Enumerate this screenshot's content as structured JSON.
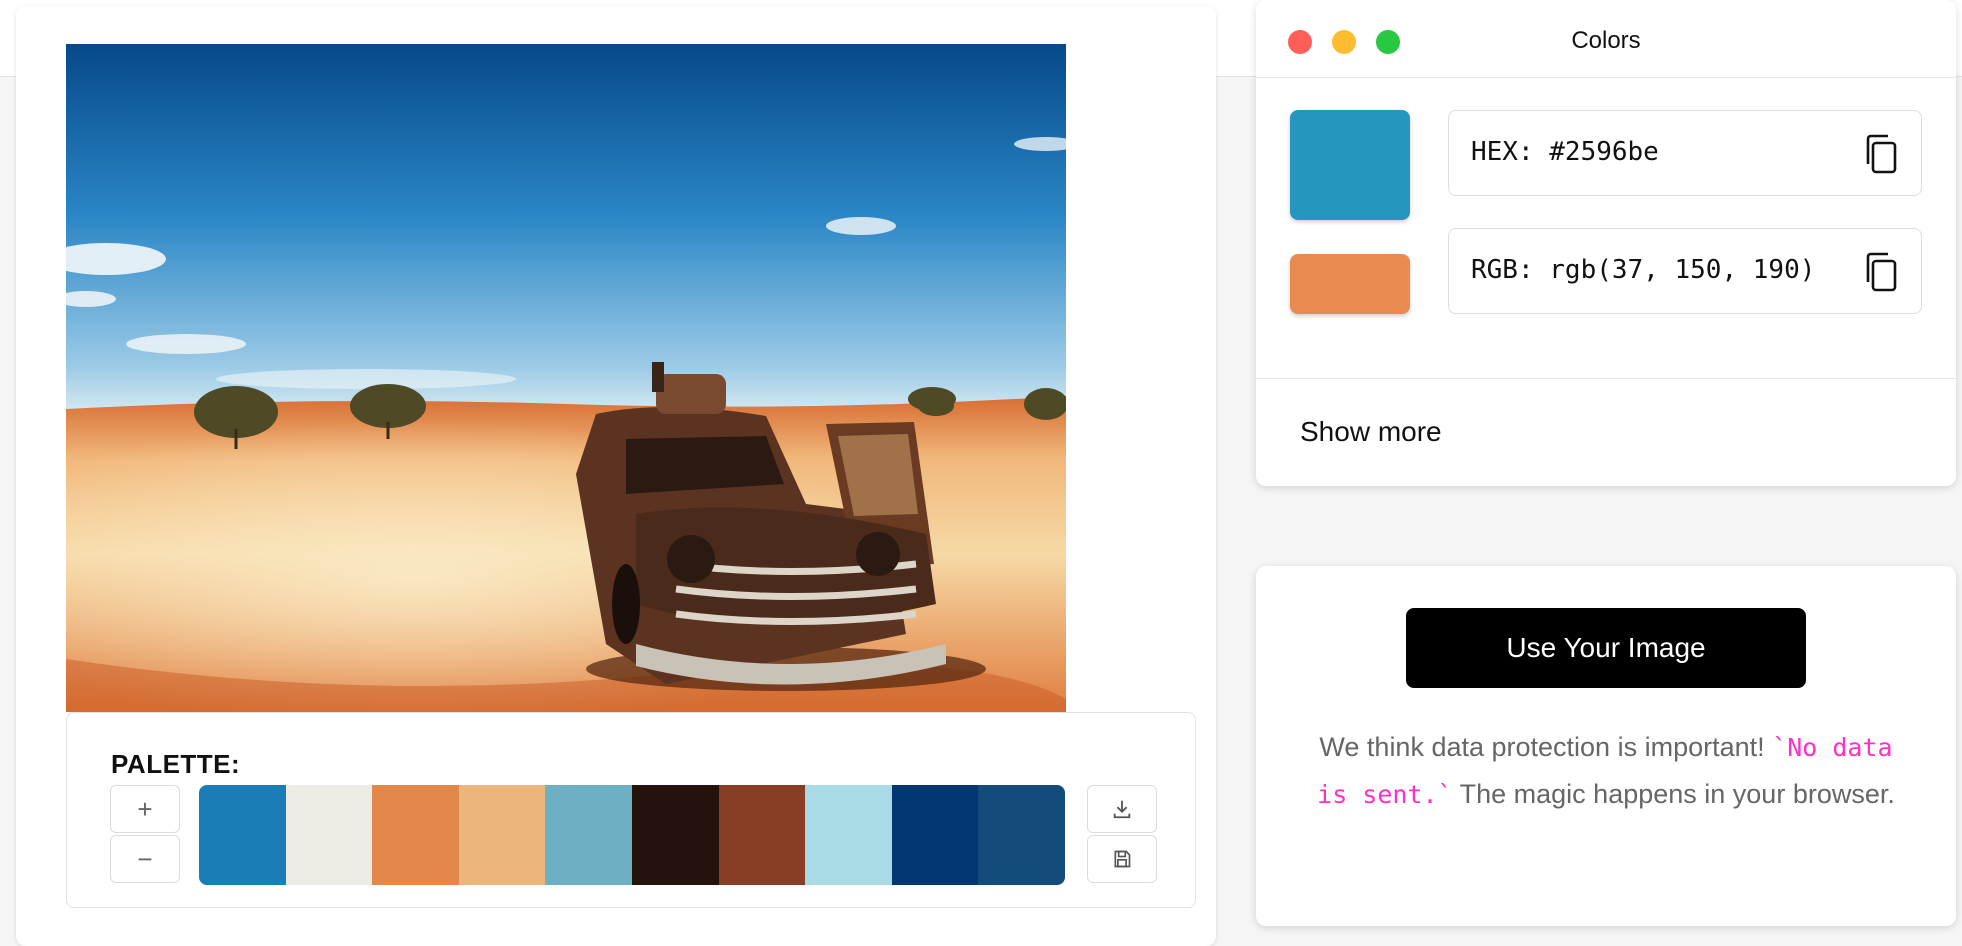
{
  "photo": {
    "alt": "Rusted abandoned car in red desert under blue sky",
    "colors": {
      "sky_top": "#0a4f8f",
      "sky_mid": "#2b86c5",
      "sky_horizon": "#cfe6f2",
      "sand": "#e38a4a",
      "sand_light": "#f6d69a",
      "car": "#4a2a1c"
    }
  },
  "palette": {
    "title": "PALETTE:",
    "add_label": "+",
    "remove_label": "−",
    "swatches": [
      "#1a7db5",
      "#ecebe4",
      "#e3874a",
      "#ebb67c",
      "#6eb0c3",
      "#23130c",
      "#873e24",
      "#a8dbe5",
      "#023773",
      "#134b7a"
    ]
  },
  "colors_window": {
    "title": "Colors",
    "traffic_lights": {
      "close": "#ff5f57",
      "minimize": "#febc2e",
      "maximize": "#28c840"
    },
    "selected_color": "#2596be",
    "secondary_color": "#e98a51",
    "hex_text": "HEX: #2596be",
    "rgb_text": "RGB: rgb(37, 150, 190)",
    "show_more": "Show more"
  },
  "upload": {
    "button_label": "Use Your Image",
    "notice_prefix": "We think data protection is important!",
    "notice_code": "`No data is sent.`",
    "notice_suffix": "The magic happens in your browser."
  }
}
